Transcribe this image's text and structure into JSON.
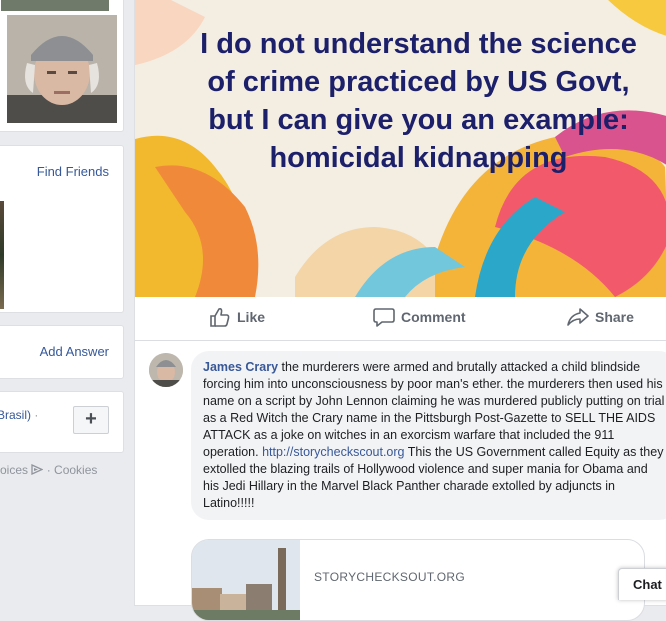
{
  "left_column": {
    "friends_link": "Find Friends",
    "answer_link": "Add Answer",
    "language": "Brasil)",
    "language_separator": "·",
    "add_button": "+",
    "footer": {
      "choices": "oices",
      "separator": "·",
      "cookies": "Cookies"
    }
  },
  "post": {
    "banner_lines": [
      "I do not understand the science",
      "of crime practiced by US Govt,",
      "but I can give you an example:",
      "homicidal kidnapping"
    ],
    "actions": {
      "like": "Like",
      "comment": "Comment",
      "share": "Share"
    },
    "comment": {
      "author": "James Crary",
      "text_before_link": " the murderers were armed and brutally attacked a child blindside forcing him into unconsciousness by poor man's ether. the murderers then used his name on a script by John Lennon claiming he was murdered publicly putting on trial as a Red Witch the Crary name in the Pittsburgh Post-Gazette to SELL THE AIDS ATTACK as a joke on witches in an exorcism warfare that included the 911 operation. ",
      "link": "http://storycheckscout.org",
      "text_after_link": " This the US Government called Equity as they extolled the blazing trails of Hollywood violence and super mania for Obama and his Jedi Hillary in the Marvel Black Panther charade extolled by adjuncts in Latino!!!!!"
    },
    "preview": {
      "domain": "STORYCHECKSOUT.ORG"
    }
  },
  "chat": {
    "label": "Chat"
  },
  "colors": {
    "link": "#365899",
    "banner_text": "#1c1f6a",
    "page_bg": "#e9ebee"
  }
}
